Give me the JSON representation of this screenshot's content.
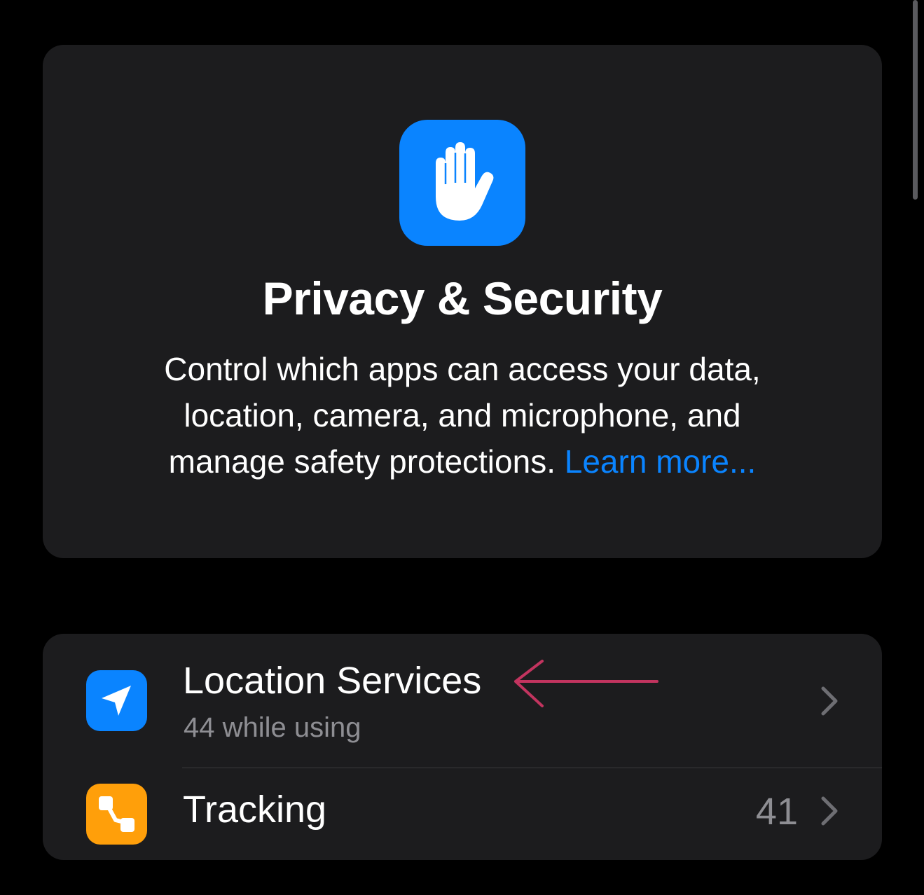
{
  "header": {
    "icon": "hand-raised-icon",
    "title": "Privacy & Security",
    "description_lines": [
      "Control which apps can access your data,",
      "location, camera, and microphone, and",
      "manage safety protections. "
    ],
    "learn_more": "Learn more..."
  },
  "list": {
    "items": [
      {
        "icon": "location-arrow-icon",
        "title": "Location Services",
        "subtitle": "44 while using"
      },
      {
        "icon": "tracking-icon",
        "title": "Tracking",
        "value": "41"
      }
    ]
  },
  "colors": {
    "background": "#000000",
    "card": "#1c1c1e",
    "accent_blue": "#0a84ff",
    "tracking_orange": "#ff9f0a",
    "secondary_text": "#8e8e93",
    "annotation_arrow": "#c2345f"
  }
}
